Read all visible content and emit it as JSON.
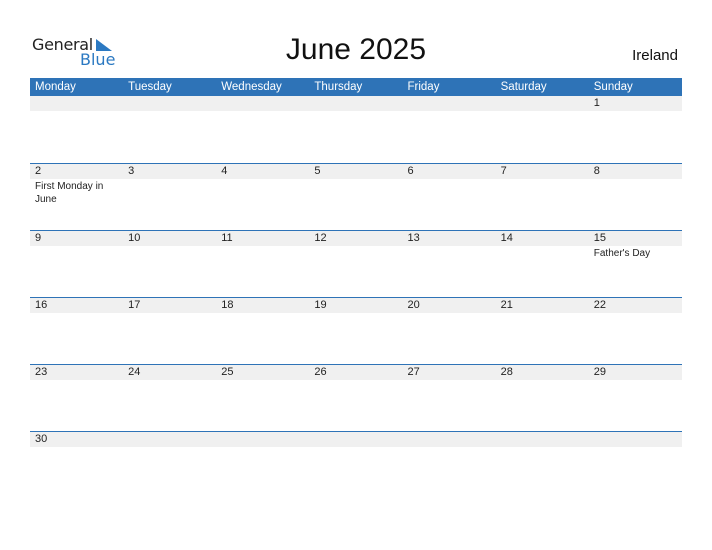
{
  "logo": {
    "general": "General",
    "blue": "Blue",
    "brand_color": "#2b79c2"
  },
  "title": "June 2025",
  "country": "Ireland",
  "header_color": "#2e73b7",
  "weekdays": [
    "Monday",
    "Tuesday",
    "Wednesday",
    "Thursday",
    "Friday",
    "Saturday",
    "Sunday"
  ],
  "weeks": [
    [
      {
        "day": ""
      },
      {
        "day": ""
      },
      {
        "day": ""
      },
      {
        "day": ""
      },
      {
        "day": ""
      },
      {
        "day": ""
      },
      {
        "day": "1"
      }
    ],
    [
      {
        "day": "2",
        "holiday": "First Monday in June"
      },
      {
        "day": "3"
      },
      {
        "day": "4"
      },
      {
        "day": "5"
      },
      {
        "day": "6"
      },
      {
        "day": "7"
      },
      {
        "day": "8"
      }
    ],
    [
      {
        "day": "9"
      },
      {
        "day": "10"
      },
      {
        "day": "11"
      },
      {
        "day": "12"
      },
      {
        "day": "13"
      },
      {
        "day": "14"
      },
      {
        "day": "15",
        "holiday": "Father's Day"
      }
    ],
    [
      {
        "day": "16"
      },
      {
        "day": "17"
      },
      {
        "day": "18"
      },
      {
        "day": "19"
      },
      {
        "day": "20"
      },
      {
        "day": "21"
      },
      {
        "day": "22"
      }
    ],
    [
      {
        "day": "23"
      },
      {
        "day": "24"
      },
      {
        "day": "25"
      },
      {
        "day": "26"
      },
      {
        "day": "27"
      },
      {
        "day": "28"
      },
      {
        "day": "29"
      }
    ],
    [
      {
        "day": "30"
      },
      {
        "day": ""
      },
      {
        "day": ""
      },
      {
        "day": ""
      },
      {
        "day": ""
      },
      {
        "day": ""
      },
      {
        "day": ""
      }
    ]
  ]
}
